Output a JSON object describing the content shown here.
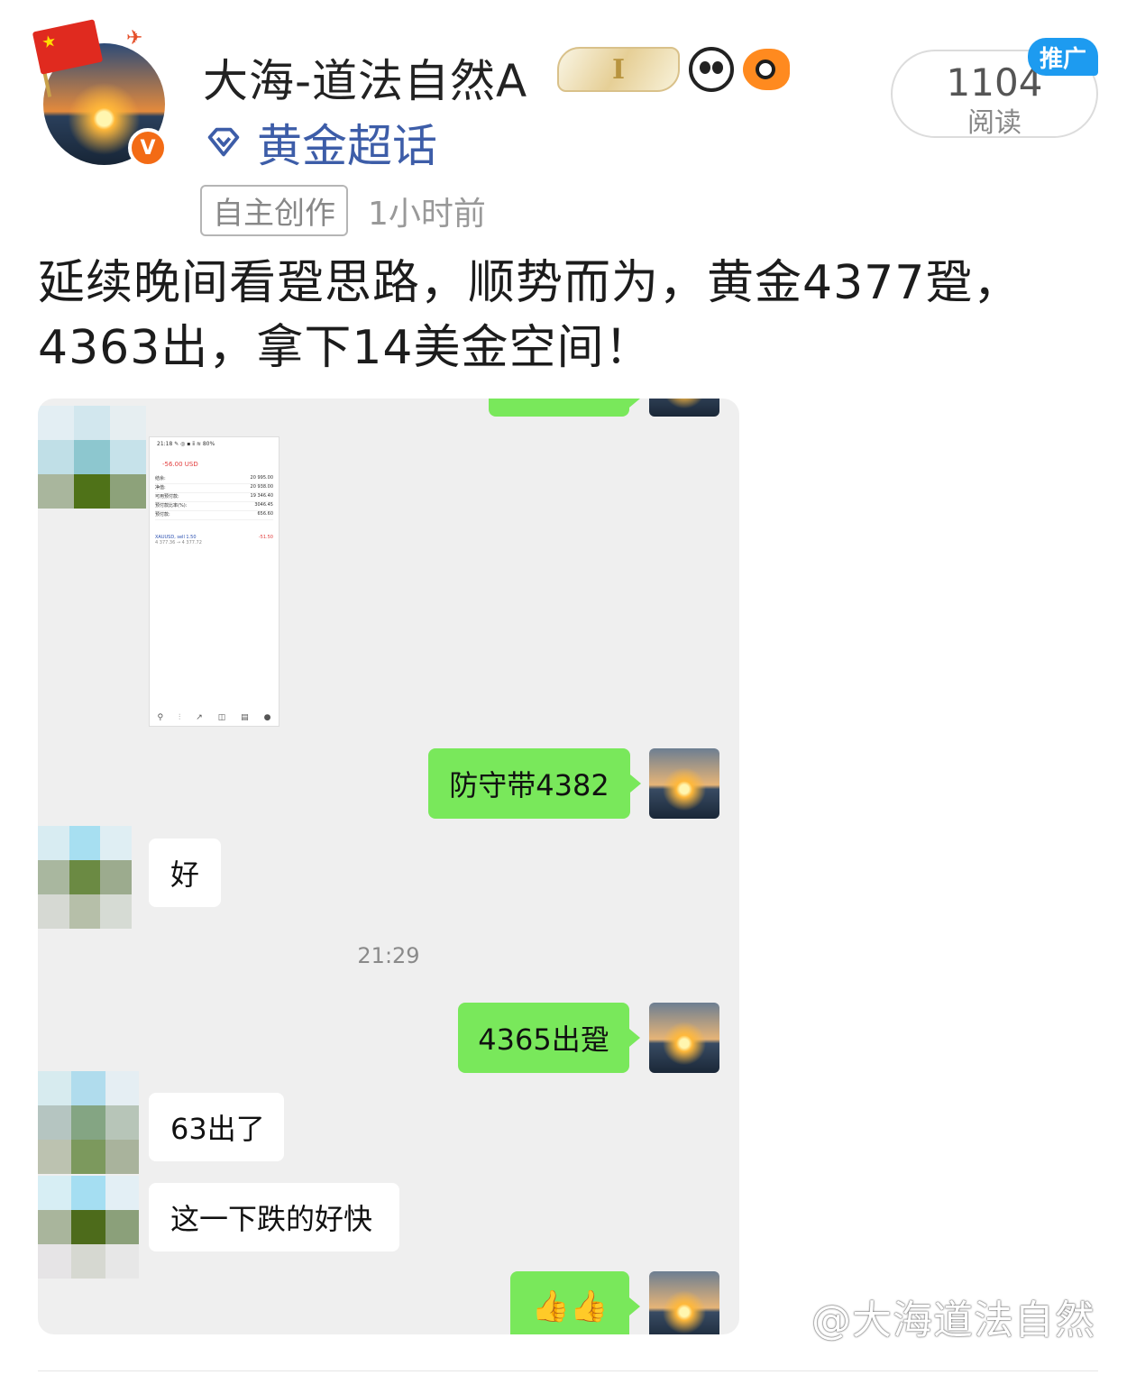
{
  "user": {
    "name": "大海-道法自然A",
    "level_badge": "I",
    "verified_badge": "V"
  },
  "topic": "黄金超话",
  "meta": {
    "tag": "自主创作",
    "time": "1小时前"
  },
  "read_card": {
    "count": "1104",
    "label": "阅读",
    "promo": "推广"
  },
  "post": {
    "text": "延续晚间看跫思路，顺势而为，黄金4377跫，4363出，拿下14美金空间！"
  },
  "chat": {
    "phone_screenshot": {
      "status": "21:18 ✎ ◎                ▪ ⅱ ≋ 80%",
      "loss": "-56.00 USD",
      "rows": [
        {
          "label": "结余:",
          "value": "20 995.00"
        },
        {
          "label": "净值:",
          "value": "20 938.00"
        },
        {
          "label": "可用预付款:",
          "value": "19 346.40"
        },
        {
          "label": "预付款比率(%):",
          "value": "3046.45"
        },
        {
          "label": "预付款:",
          "value": "656.60"
        }
      ],
      "position_symbol": "XAUUSD, sell 1.50",
      "position_prices": "4 377.36 → 4 377.72",
      "position_pl": "-51.50"
    },
    "messages": [
      {
        "side": "right",
        "text": "防守带4382"
      },
      {
        "side": "left",
        "text": "好"
      },
      {
        "side": "right",
        "text": "4365出跫"
      },
      {
        "side": "left",
        "text": "63出了"
      },
      {
        "side": "left",
        "text": "这一下跌的好快"
      },
      {
        "side": "right",
        "text": "👍👍"
      }
    ],
    "timestamp": "21:29"
  },
  "watermark": "@大海道法自然"
}
